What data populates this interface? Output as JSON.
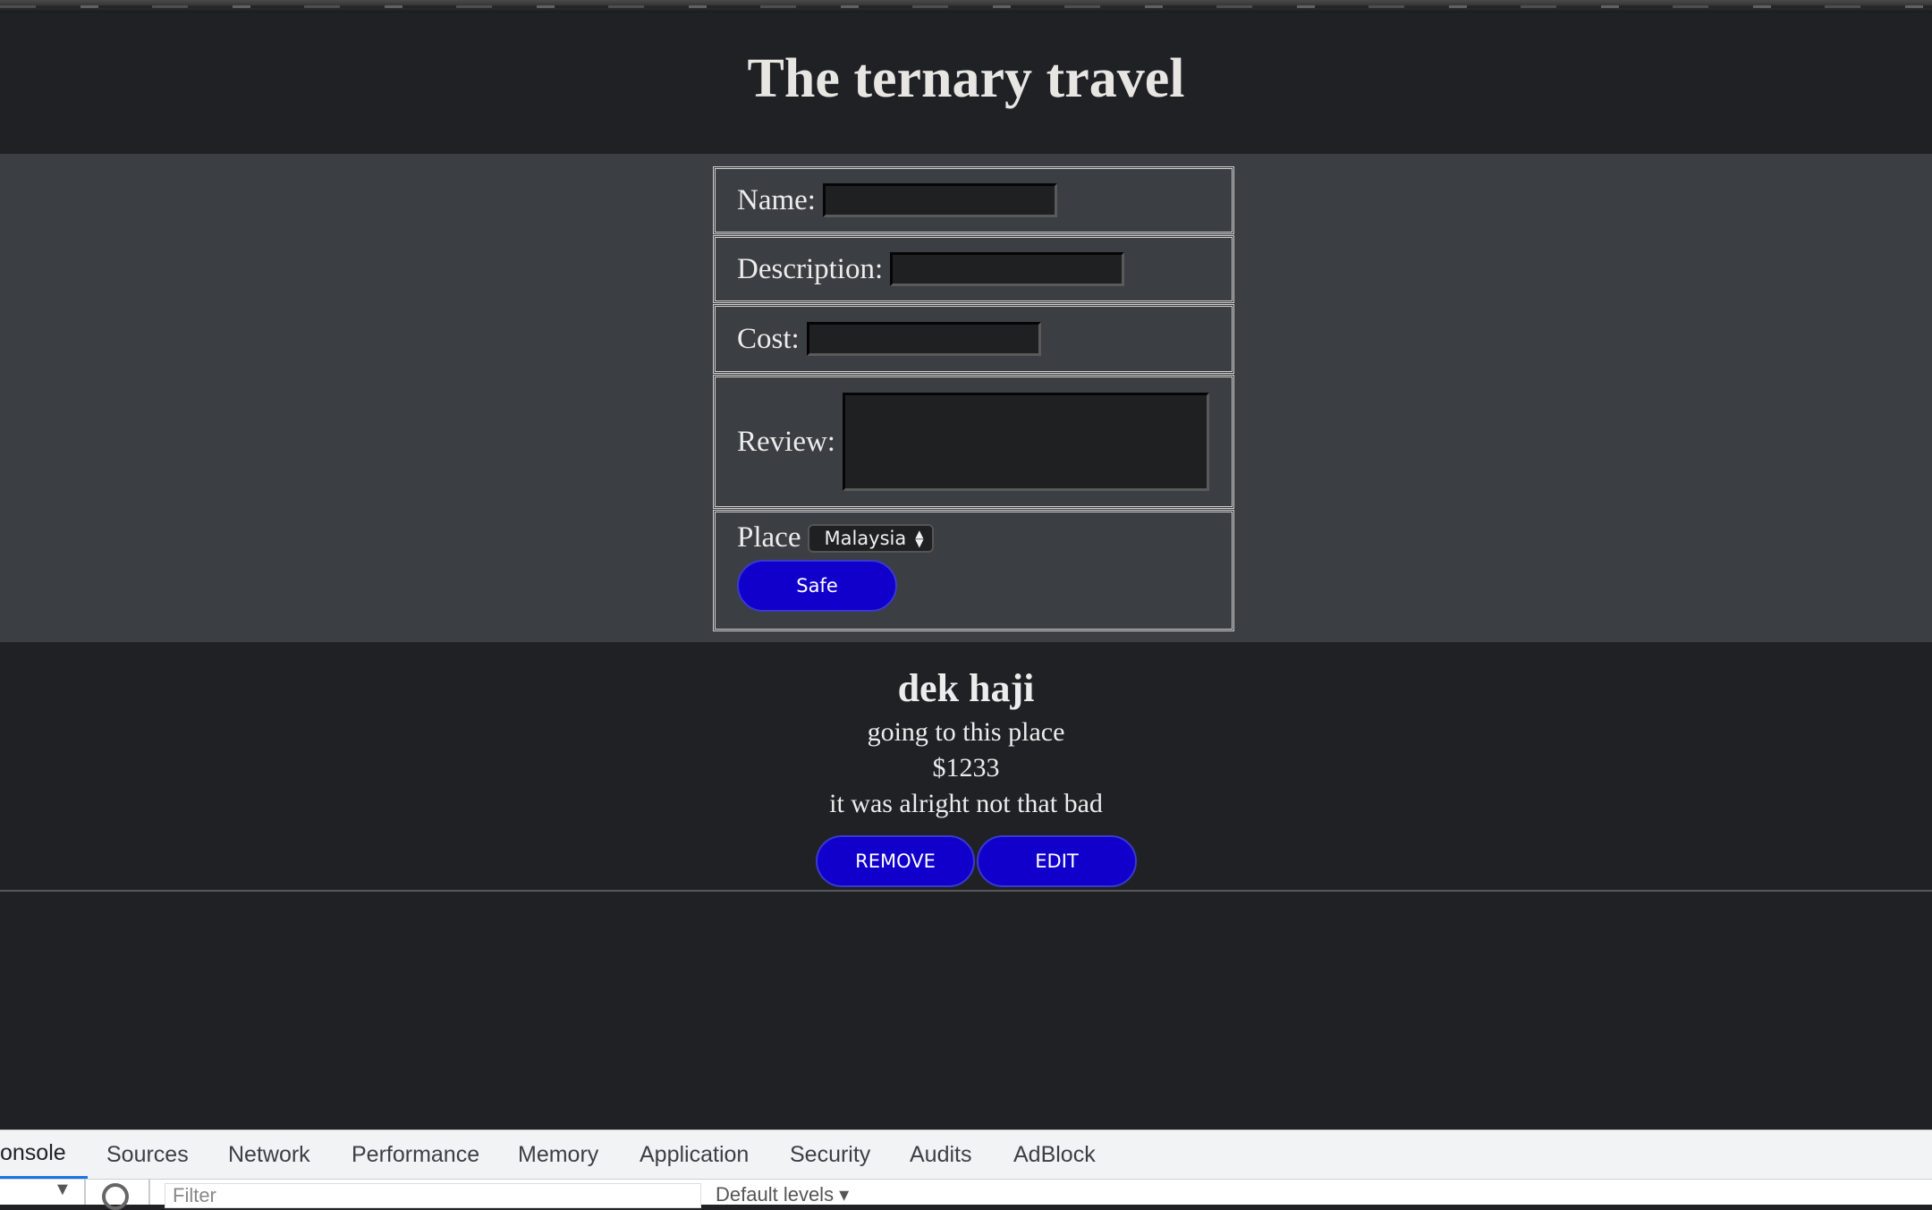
{
  "app": {
    "title": "The ternary travel"
  },
  "form": {
    "name_label": "Name:",
    "name_value": "",
    "description_label": "Description:",
    "description_value": "",
    "cost_label": "Cost:",
    "cost_value": "",
    "review_label": "Review:",
    "review_value": "",
    "place_label": "Place",
    "place_selected": "Malaysia",
    "save_label": "Safe"
  },
  "entry": {
    "name": "dek haji",
    "description": "going to this place",
    "cost": "$1233",
    "review": "it was alright not that bad",
    "remove_label": "REMOVE",
    "edit_label": "EDIT"
  },
  "devtools": {
    "tabs": [
      "onsole",
      "Sources",
      "Network",
      "Performance",
      "Memory",
      "Application",
      "Security",
      "Audits",
      "AdBlock"
    ],
    "active_tab": "onsole",
    "filter_placeholder": "Filter",
    "levels_label": "Default levels ▾"
  },
  "colors": {
    "accent_button": "#1100cc",
    "page_bg": "#202124",
    "form_bg": "#3b3e42"
  }
}
